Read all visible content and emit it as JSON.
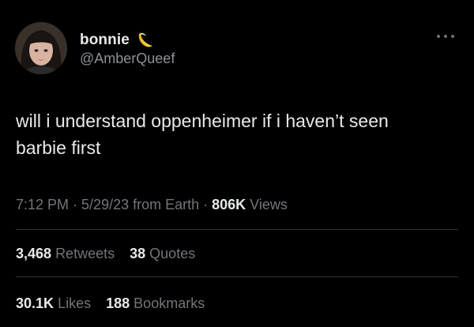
{
  "user": {
    "display_name": "bonnie",
    "name_emoji": "banana-icon",
    "handle": "@AmberQueef"
  },
  "tweet": {
    "text_line1": "will i understand oppenheimer if i haven’t seen",
    "text_line2": "barbie first"
  },
  "meta": {
    "time": "7:12 PM",
    "sep1": " · ",
    "date": "5/29/23",
    "source": " from Earth",
    "sep2": " · ",
    "views_count": "806K",
    "views_label": " Views"
  },
  "stats": {
    "retweets_count": "3,468",
    "retweets_label": "Retweets",
    "quotes_count": "38",
    "quotes_label": "Quotes",
    "likes_count": "30.1K",
    "likes_label": "Likes",
    "bookmarks_count": "188",
    "bookmarks_label": "Bookmarks"
  },
  "colors": {
    "background": "#000000",
    "primary_text": "#e7e9ea",
    "secondary_text": "#71767b",
    "divider": "#2f3336"
  }
}
